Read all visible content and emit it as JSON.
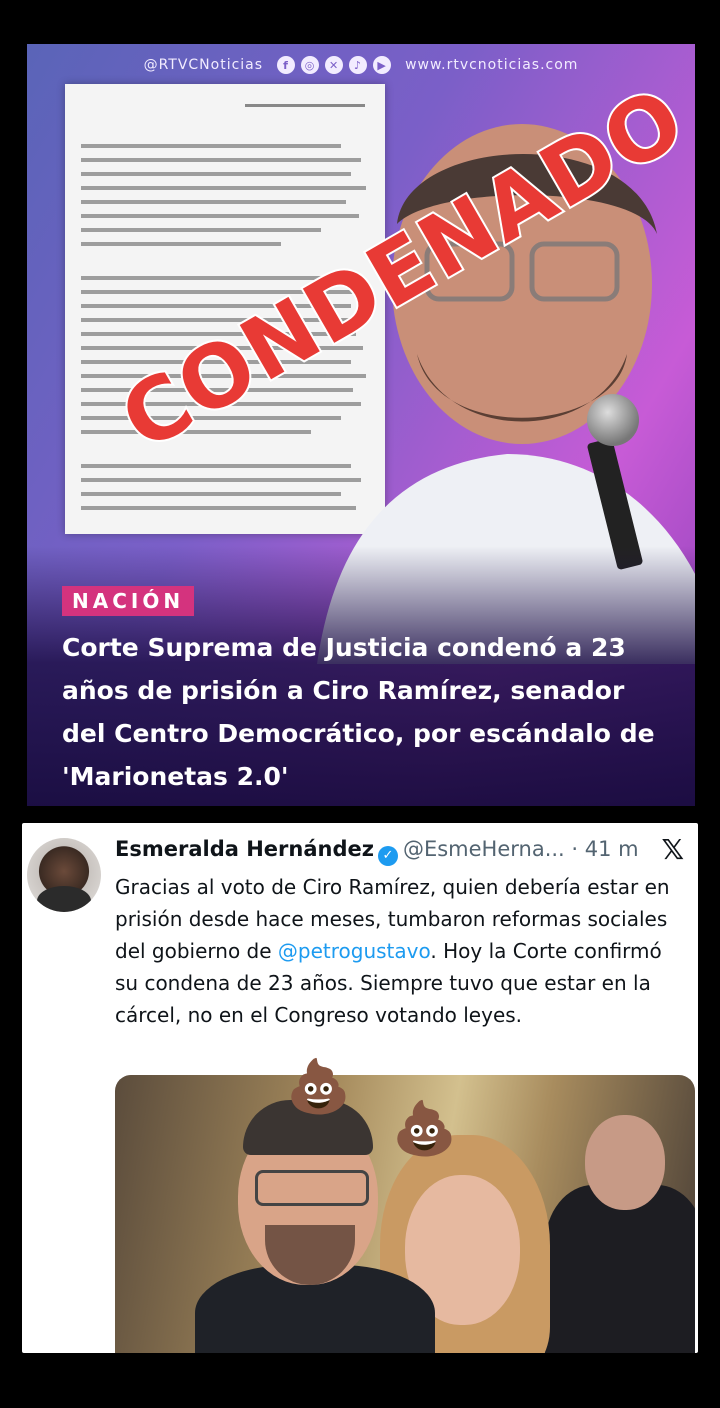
{
  "news": {
    "brand_handle": "@RTVCNoticias",
    "social_icons": [
      "facebook-icon",
      "instagram-icon",
      "x-icon",
      "tiktok-icon",
      "youtube-icon"
    ],
    "website": "www.rtvcnoticias.com",
    "stamp": "CONDENADO",
    "section_badge": "NACIÓN",
    "headline": "Corte Suprema de Justicia condenó a 23 años de prisión a Ciro Ramírez, senador del Centro Democrático, por escándalo de 'Marionetas 2.0'",
    "colors": {
      "badge": "#d4337e",
      "stamp": "#e83a35"
    }
  },
  "tweet": {
    "author_name": "Esmeralda Hernández",
    "handle": "@EsmeHerna...",
    "separator": "·",
    "time": "41 m",
    "text_before_mention": "Gracias al voto de Ciro Ramírez, quien debería estar en prisión desde hace meses, tumbaron reformas sociales del gobierno de ",
    "mention": "@petrogustavo",
    "text_after_mention": ". Hoy la Corte confirmó su condena de 23 años. Siempre tuvo que estar en la cárcel, no en el Congreso votando leyes.",
    "photo_overlay_emoji": "💩",
    "colors": {
      "link": "#1d9bf0",
      "verified": "#1d9bf0"
    }
  }
}
